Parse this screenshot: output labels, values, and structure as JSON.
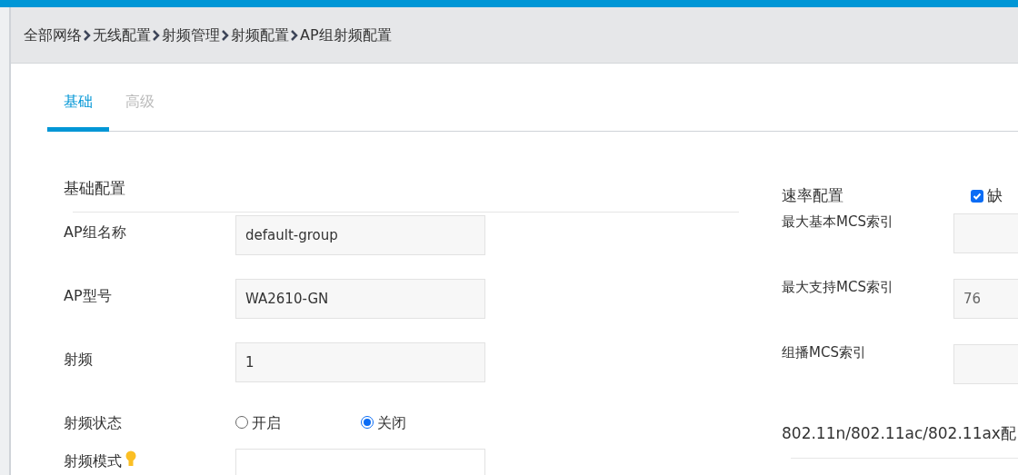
{
  "breadcrumb": [
    "全部网络",
    "无线配置",
    "射频管理",
    "射频配置",
    "AP组射频配置"
  ],
  "tabs": [
    {
      "label": "基础",
      "selected": true
    },
    {
      "label": "高级",
      "selected": false
    }
  ],
  "basic": {
    "title": "基础配置",
    "rows": [
      {
        "kind": "input",
        "label": "AP组名称",
        "value": "default-group"
      },
      {
        "kind": "input",
        "label": "AP型号",
        "value": "WA2610-GN"
      },
      {
        "kind": "input",
        "label": "射频",
        "value": "1"
      },
      {
        "kind": "radio",
        "label": "射频状态",
        "options": [
          {
            "label": "开启",
            "selected": false
          },
          {
            "label": "关闭",
            "selected": true
          }
        ]
      },
      {
        "kind": "select",
        "label": "射频模式",
        "hint": true
      }
    ]
  },
  "rate": {
    "title": "速率配置",
    "default_checkbox": {
      "label": "缺",
      "checked": true
    },
    "rows": [
      {
        "label": "最大基本MCS索引",
        "value": ""
      },
      {
        "label": "最大支持MCS索引",
        "value": "76"
      },
      {
        "label": "组播MCS索引",
        "value": ""
      }
    ],
    "section_title": "802.11n/802.11ac/802.11ax配"
  }
}
